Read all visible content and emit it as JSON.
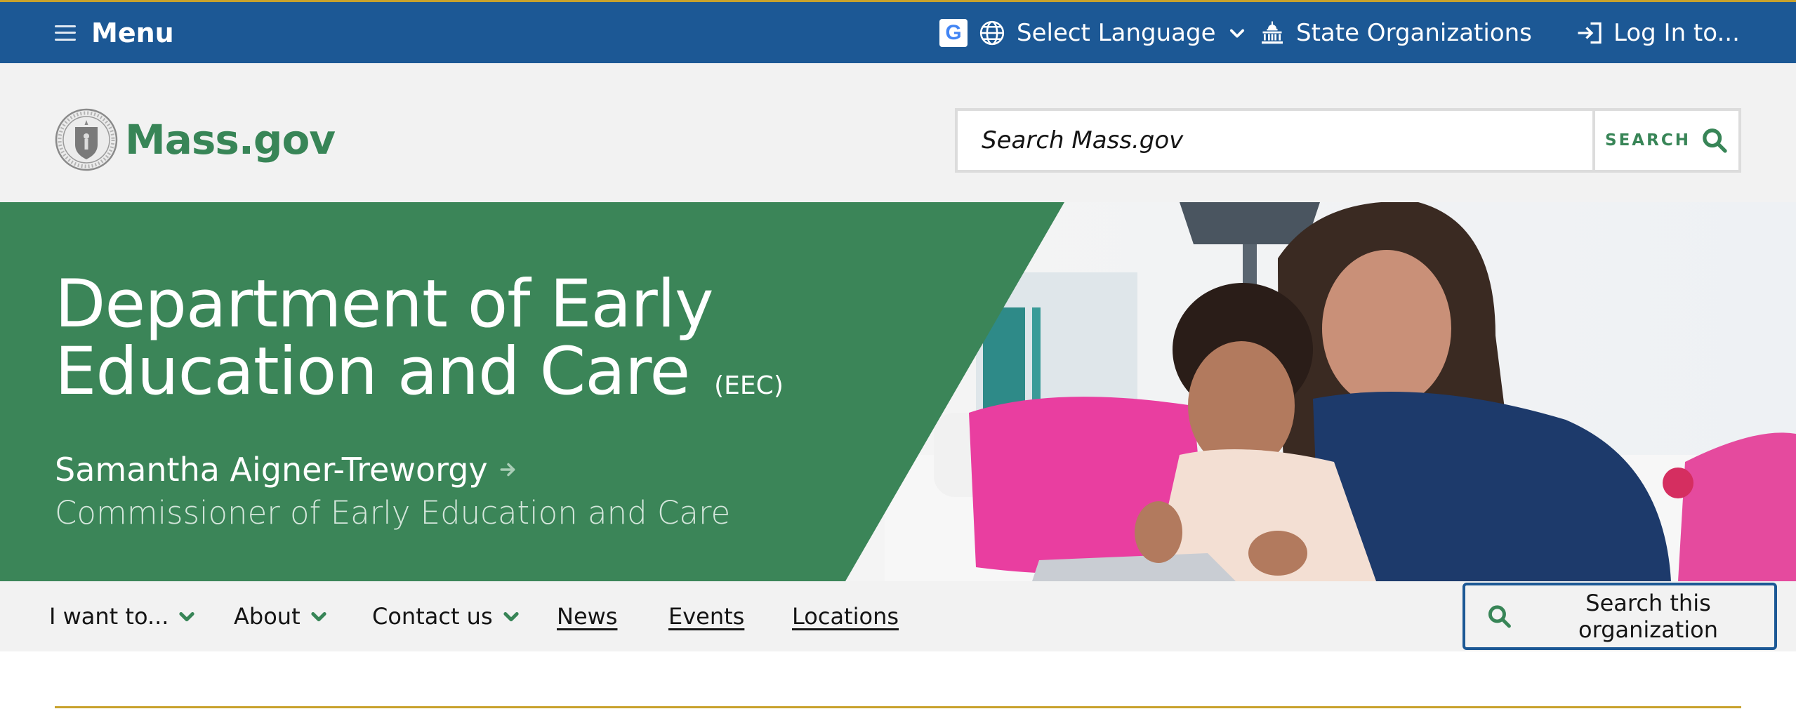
{
  "topbar": {
    "menu_label": "Menu",
    "translate_badge": "G",
    "language_label": "Select Language",
    "state_orgs_label": "State Organizations",
    "login_label": "Log In to..."
  },
  "header": {
    "logo_text": "Mass.gov",
    "search_placeholder": "Search Mass.gov",
    "search_button_label": "SEARCH"
  },
  "hero": {
    "title_line1": "Department of Early",
    "title_line2": "Education and Care",
    "abbreviation": "(EEC)",
    "person_name": "Samantha Aigner-Treworgy",
    "person_role": "Commissioner of Early Education and Care"
  },
  "org_nav": {
    "items": [
      {
        "label": "I want to...",
        "dropdown": true
      },
      {
        "label": "About",
        "dropdown": true
      },
      {
        "label": "Contact us",
        "dropdown": true
      },
      {
        "label": "News",
        "dropdown": false
      },
      {
        "label": "Events",
        "dropdown": false
      },
      {
        "label": "Locations",
        "dropdown": false
      }
    ],
    "search_org_label": "Search this organization"
  },
  "colors": {
    "topbar_blue": "#1c5895",
    "brand_green": "#388557",
    "hero_green": "#3b8558",
    "gold_accent": "#c8a22c",
    "header_gray": "#f2f2f2"
  },
  "icons": {
    "menu": "hamburger-icon",
    "translate": "google-translate-icon",
    "language": "globe-icon",
    "language_toggle": "chevron-down-icon",
    "state_orgs": "capitol-building-icon",
    "login": "login-icon",
    "logo": "massachusetts-seal-icon",
    "search": "search-icon",
    "person_link": "arrow-right-icon",
    "nav_dropdown": "chevron-down-icon"
  }
}
